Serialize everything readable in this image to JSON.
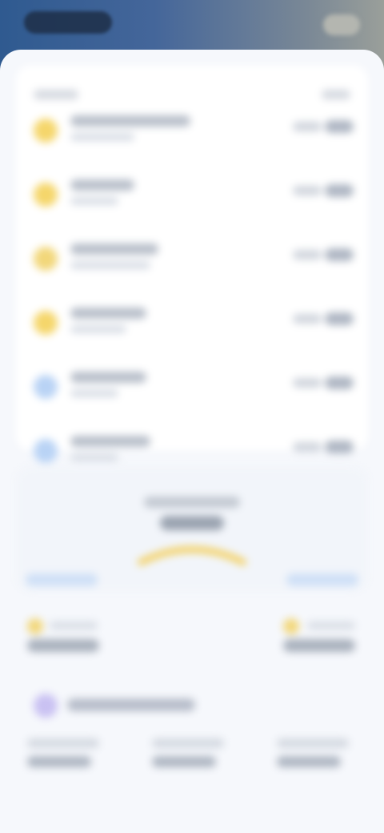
{
  "header": {
    "app_title": "",
    "action": ""
  },
  "list": {
    "column_left": "",
    "column_right": "",
    "rows": [
      {
        "icon": "sun-icon",
        "color": "#f5d66b",
        "name": "",
        "sub": "",
        "value": "",
        "change": ""
      },
      {
        "icon": "sun-icon",
        "color": "#f5d66b",
        "name": "",
        "sub": "",
        "value": "",
        "change": ""
      },
      {
        "icon": "sun-icon",
        "color": "#f2d77a",
        "name": "",
        "sub": "",
        "value": "",
        "change": ""
      },
      {
        "icon": "sun-icon",
        "color": "#f5d66b",
        "name": "",
        "sub": "",
        "value": "",
        "change": ""
      },
      {
        "icon": "drop-icon",
        "color": "#b9d3f5",
        "name": "",
        "sub": "",
        "value": "",
        "change": ""
      },
      {
        "icon": "drop-icon",
        "color": "#b9d3f5",
        "name": "",
        "sub": "",
        "value": "",
        "change": ""
      }
    ]
  },
  "summary": {
    "title": "",
    "value": "",
    "left_chip": "",
    "right_chip": "",
    "accent": "#f3cf5e"
  },
  "stats": [
    {
      "label": "",
      "value": ""
    },
    {
      "label": "",
      "value": ""
    }
  ],
  "features": {
    "title": "",
    "icon": "star-icon",
    "items": [
      {
        "label": "",
        "value": ""
      },
      {
        "label": "",
        "value": ""
      },
      {
        "label": "",
        "value": ""
      }
    ]
  }
}
